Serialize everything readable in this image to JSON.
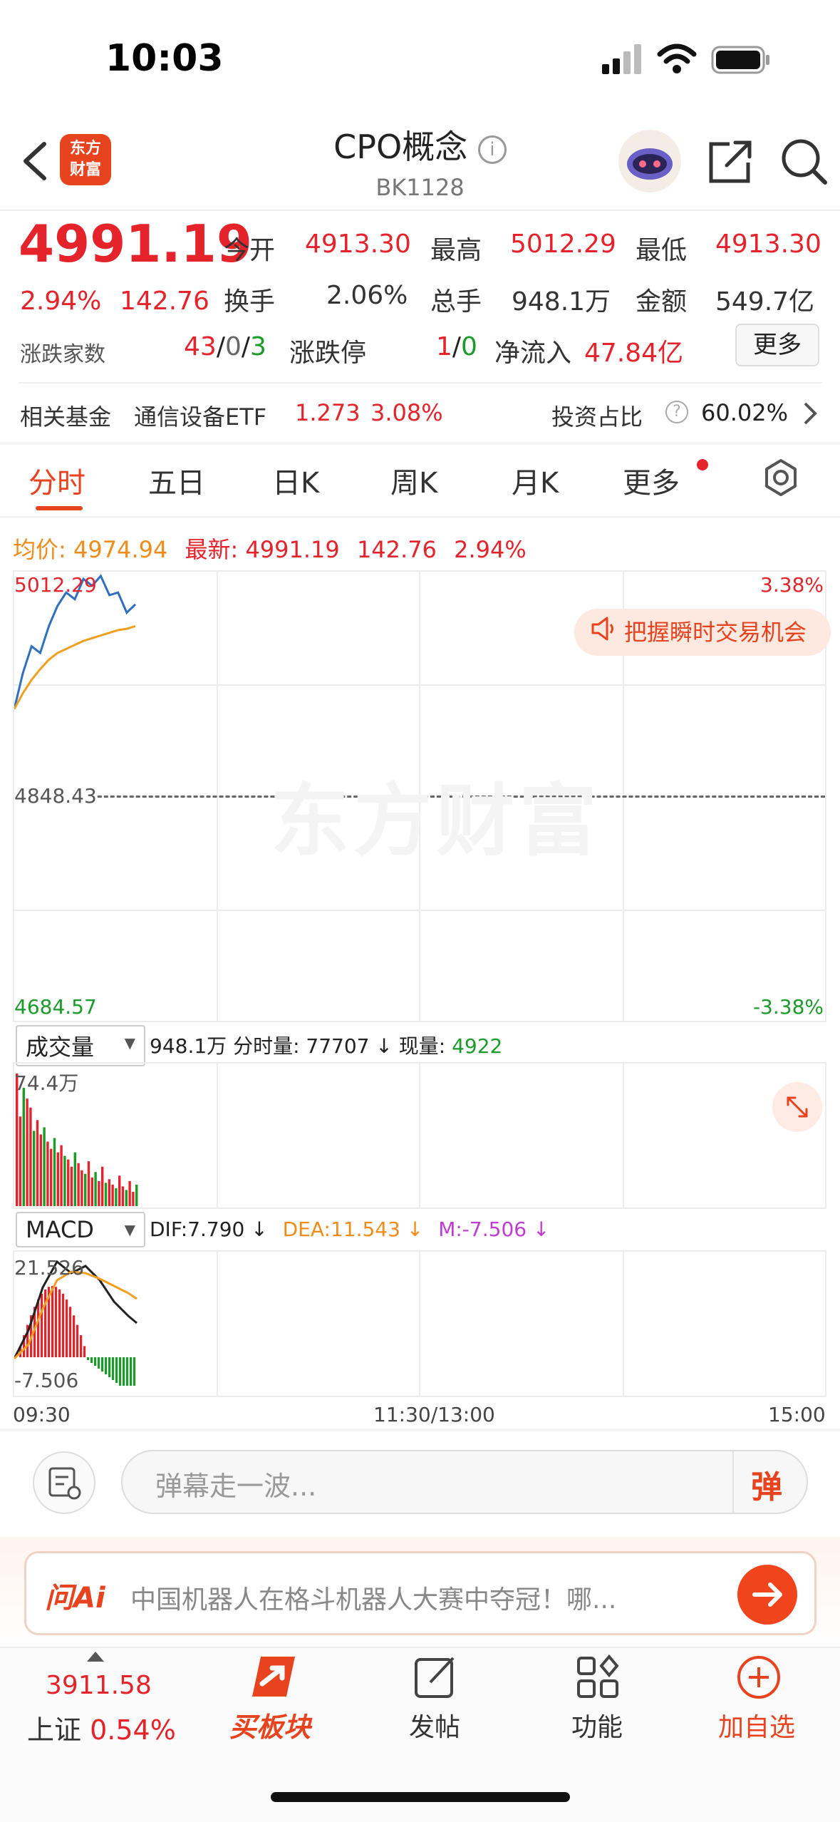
{
  "status": {
    "time": "10:03"
  },
  "header": {
    "logo_line1": "东方",
    "logo_line2": "财富",
    "title": "CPO概念",
    "code": "BK1128"
  },
  "quote": {
    "price": "4991.19",
    "change_pct": "2.94%",
    "change": "142.76",
    "open_label": "今开",
    "open": "4913.30",
    "high_label": "最高",
    "high": "5012.29",
    "low_label": "最低",
    "low": "4913.30",
    "turnover_label": "换手",
    "turnover": "2.06%",
    "volume_label": "总手",
    "volume": "948.1万",
    "amount_label": "金额",
    "amount": "549.7亿",
    "breadth_label": "涨跌家数",
    "up": "43",
    "flat": "0",
    "down": "3",
    "limit_label": "涨跌停",
    "limit_up": "1",
    "limit_down": "0",
    "netflow_label": "净流入",
    "netflow": "47.84亿",
    "more_button": "更多"
  },
  "fund": {
    "label": "相关基金",
    "name": "通信设备ETF",
    "price": "1.273",
    "pct": "3.08%",
    "ratio_label": "投资占比",
    "ratio": "60.02%"
  },
  "tabs": [
    "分时",
    "五日",
    "日K",
    "周K",
    "月K",
    "更多"
  ],
  "price_chart": {
    "avg_label": "均价:",
    "avg_value": "4974.94",
    "latest_label": "最新:",
    "latest_value": "4991.19",
    "latest_change": "142.76",
    "latest_pct": "2.94%",
    "y_top": "5012.29",
    "y_mid": "4848.43",
    "y_bottom": "4684.57",
    "pct_top": "3.38%",
    "pct_bottom": "-3.38%",
    "watermark": "东方财富",
    "promo": "把握瞬时交易机会"
  },
  "volume_chart": {
    "select": "成交量",
    "total": "948.1万",
    "period_label": "分时量:",
    "period_value": "77707",
    "current_label": "现量:",
    "current_value": "4922",
    "max": "74.4万"
  },
  "macd_chart": {
    "select": "MACD",
    "dif": "DIF:7.790",
    "dea": "DEA:11.543",
    "m": "M:-7.506",
    "top": "21.526",
    "bottom": "-7.506"
  },
  "time_axis": {
    "start": "09:30",
    "mid": "11:30/13:00",
    "end": "15:00"
  },
  "comment": {
    "placeholder": "弹幕走一波...",
    "danmaku_button": "弹"
  },
  "ai": {
    "label": "问Ai",
    "text": "中国机器人在格斗机器人大赛中夺冠！哪..."
  },
  "bottom_nav": {
    "index_value": "3911.58",
    "index_name": "上证",
    "index_pct": "0.54%",
    "buy_sector": "买板块",
    "post": "发帖",
    "functions": "功能",
    "add_watch": "加自选"
  },
  "chart_data": {
    "type": "line",
    "series": [
      {
        "values": [
          4913.3,
          4940,
          4960,
          4955,
          4975,
          4990,
          5000,
          4995,
          5010,
          5005,
          5012.29,
          4998,
          5000,
          4985,
          4991.19
        ]
      },
      {
        "values": [
          4913.3,
          4925,
          4935,
          4943,
          4950,
          4955,
          4958,
          4961,
          4964,
          4966,
          4968,
          4970,
          4972,
          4973,
          4974.94
        ]
      }
    ],
    "volume": [
      74,
      50,
      66,
      60,
      55,
      42,
      48,
      40,
      44,
      36,
      32,
      38,
      30,
      34,
      28,
      26,
      22,
      30,
      24,
      20,
      18,
      25,
      16,
      19,
      14,
      22,
      13,
      15,
      12,
      10,
      17,
      11,
      9,
      14,
      8,
      12
    ],
    "ylim": [
      4684.57,
      5012.29
    ]
  }
}
